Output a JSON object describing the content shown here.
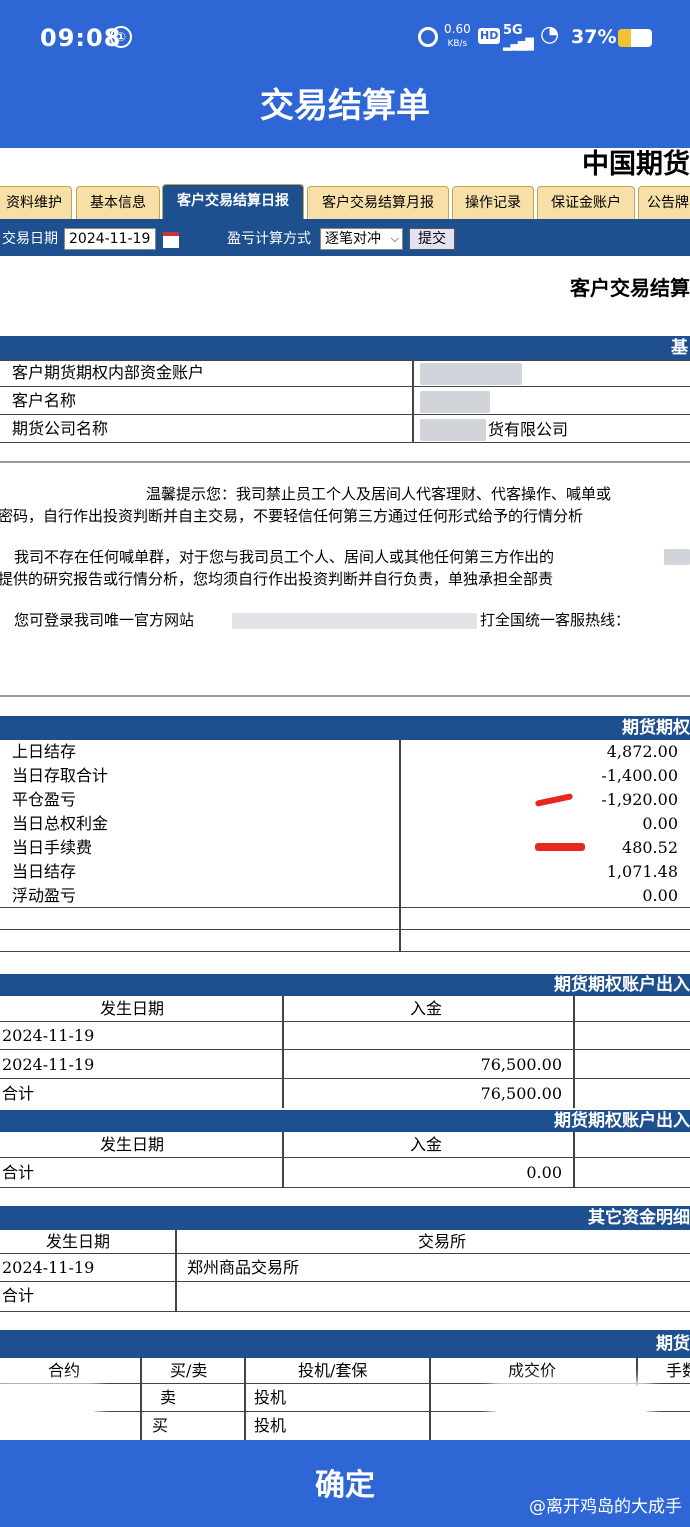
{
  "status_bar": {
    "time": "09:08",
    "speed": "0.60",
    "speed_unit": "KB/s",
    "hd": "HD",
    "network": "5G",
    "battery": "37%"
  },
  "header": {
    "title": "交易结算单"
  },
  "company": "中国期货",
  "tabs": [
    "资料维护",
    "基本信息",
    "客户交易结算日报",
    "客户交易结算月报",
    "操作记录",
    "保证金账户",
    "公告牌"
  ],
  "active_tab": "客户交易结算日报",
  "filter": {
    "date_label": "交易日期",
    "date_value": "2024-11-19",
    "pl_label": "盈亏计算方式",
    "pl_value": "逐笔对冲",
    "pl_arrow": "chevron-down-icon",
    "submit": "提交"
  },
  "subtitle": "客户交易结算",
  "basic": {
    "section": "基",
    "rows": [
      {
        "label": "客户期货期权内部资金账户"
      },
      {
        "label": "客户名称"
      },
      {
        "label": "期货公司名称",
        "value": "货有限公司"
      }
    ]
  },
  "notice": {
    "line1": "温馨提示您：我司禁止员工个人及居间人代客理财、代客操作、喊单或",
    "line2": "密码，自行作出投资判断并自主交易，不要轻信任何第三方通过任何形式给予的行情分析",
    "line3": "我司不存在任何喊单群，对于您与我司员工个人、居间人或其他任何第三方作出的",
    "line4": "提供的研究报告或行情分析，您均须自行作出投资判断并自行负责，单独承担全部责",
    "line5a": "您可登录我司唯一官方网站",
    "line5b": "打全国统一客服热线："
  },
  "summary": {
    "section": "期货期权",
    "rows": [
      {
        "label": "上日结存",
        "value": "4,872.00"
      },
      {
        "label": "当日存取合计",
        "value": "-1,400.00"
      },
      {
        "label": "平仓盈亏",
        "value": "-1,920.00"
      },
      {
        "label": "当日总权利金",
        "value": "0.00"
      },
      {
        "label": "当日手续费",
        "value": "480.52"
      },
      {
        "label": "当日结存",
        "value": "1,071.48"
      },
      {
        "label": "浮动盈亏",
        "value": "0.00"
      }
    ]
  },
  "inout1": {
    "section": "期货期权账户出入",
    "col_date": "发生日期",
    "col_in": "入金",
    "rows": [
      {
        "date": "2024-11-19",
        "amount": ""
      },
      {
        "date": "2024-11-19",
        "amount": "76,500.00"
      }
    ],
    "total_label": "合计",
    "total": "76,500.00"
  },
  "inout2": {
    "section": "期货期权账户出入",
    "col_date": "发生日期",
    "col_in": "入金",
    "total_label": "合计",
    "total": "0.00"
  },
  "other": {
    "section": "其它资金明细",
    "col_date": "发生日期",
    "col_ex": "交易所",
    "rows": [
      {
        "date": "2024-11-19",
        "exchange": "郑州商品交易所"
      }
    ],
    "total_label": "合计"
  },
  "trades": {
    "section": "期货",
    "cols": [
      "合约",
      "买/卖",
      "投机/套保",
      "成交价",
      "手数"
    ],
    "rows": [
      {
        "side": "卖",
        "type": "投机"
      },
      {
        "side": "买",
        "type": "投机"
      }
    ]
  },
  "footer": {
    "confirm": "确定",
    "watermark": "@离开鸡岛的大成手"
  },
  "colors": {
    "app_blue": "#2f66d6",
    "report_navy": "#1e4f8e",
    "tab_tan": "#f7e0a8",
    "annotation_red": "#e8281e"
  }
}
